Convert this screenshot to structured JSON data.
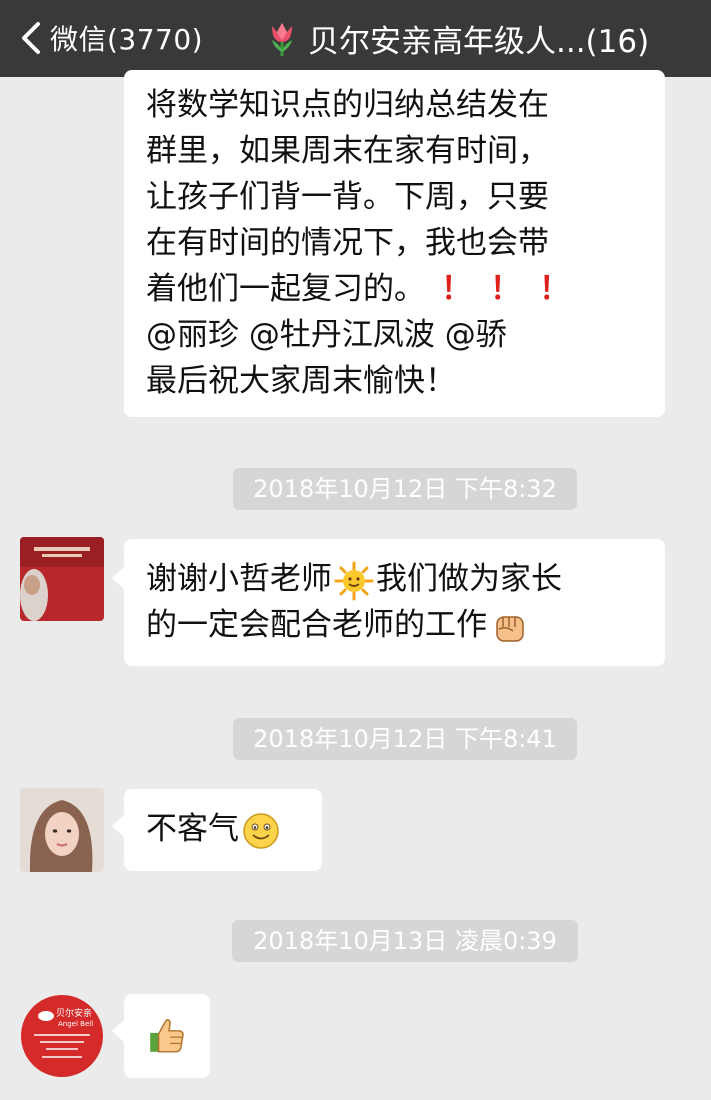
{
  "header": {
    "back_label": "微信(3770)",
    "title": "贝尔安亲高年级人...(16)"
  },
  "messages": [
    {
      "lines": [
        "将数学知识点的归纳总结发在",
        "群里，如果周末在家有时间，",
        "让孩子们背一背。下周，只要",
        "在有时间的情况下，我也会带",
        "着他们一起复习的。",
        "@丽珍 @牡丹江凤波 @骄",
        "最后祝大家周末愉快！"
      ],
      "exclamations": "！！！"
    },
    {
      "timestamp": "2018年10月12日 下午8:32",
      "line1": "谢谢小哲老师",
      "line1b": "我们做为家长",
      "line2": "的一定会配合老师的工作",
      "icons": [
        "sun-emoji-icon",
        "fist-emoji-icon"
      ]
    },
    {
      "timestamp": "2018年10月12日 下午8:41",
      "text": "不客气",
      "icons": [
        "smile-emoji-icon"
      ]
    },
    {
      "timestamp": "2018年10月13日 凌晨0:39",
      "icons": [
        "thumbs-up-emoji-icon"
      ],
      "avatar_logo": {
        "name": "贝尔安亲",
        "english": "Angel Bell"
      }
    }
  ],
  "colors": {
    "topbar": "#39393a",
    "background": "#ebebeb",
    "bubble": "#ffffff",
    "timestamp_bg": "#d6d6d6",
    "exclamation": "#e0201b",
    "brand_red": "#d42a2a"
  }
}
